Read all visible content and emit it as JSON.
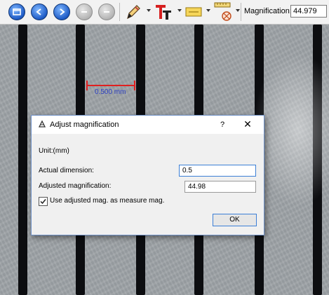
{
  "toolbar": {
    "buttons": [
      {
        "icon": "window-icon",
        "style": "blue"
      },
      {
        "icon": "back-arrow-icon",
        "style": "blue"
      },
      {
        "icon": "forward-arrow-icon",
        "style": "blue"
      },
      {
        "icon": "previous-icon",
        "style": "gray"
      },
      {
        "icon": "next-icon",
        "style": "gray"
      }
    ],
    "tools": [
      "pencil-icon",
      "text-tool-icon",
      "label-tool-icon",
      "measure-tool-icon"
    ],
    "magnification_label": "Magnification:",
    "magnification_value": "44.979"
  },
  "image": {
    "measurement_text": "0.500 mm",
    "measurement_color": "#e02020",
    "measurement_text_color": "#2b3fc2"
  },
  "dialog": {
    "title": "Adjust magnification",
    "help_label": "?",
    "close_label": "✕",
    "unit_label": "Unit:(mm)",
    "actual_dimension_label": "Actual dimension:",
    "actual_dimension_value": "0.5",
    "adjusted_magnification_label": "Adjusted magnification:",
    "adjusted_magnification_value": "44.98",
    "checkbox_label": "Use adjusted mag. as measure mag.",
    "checkbox_checked": true,
    "ok_label": "OK",
    "accent_color": "#3c7fd6"
  }
}
